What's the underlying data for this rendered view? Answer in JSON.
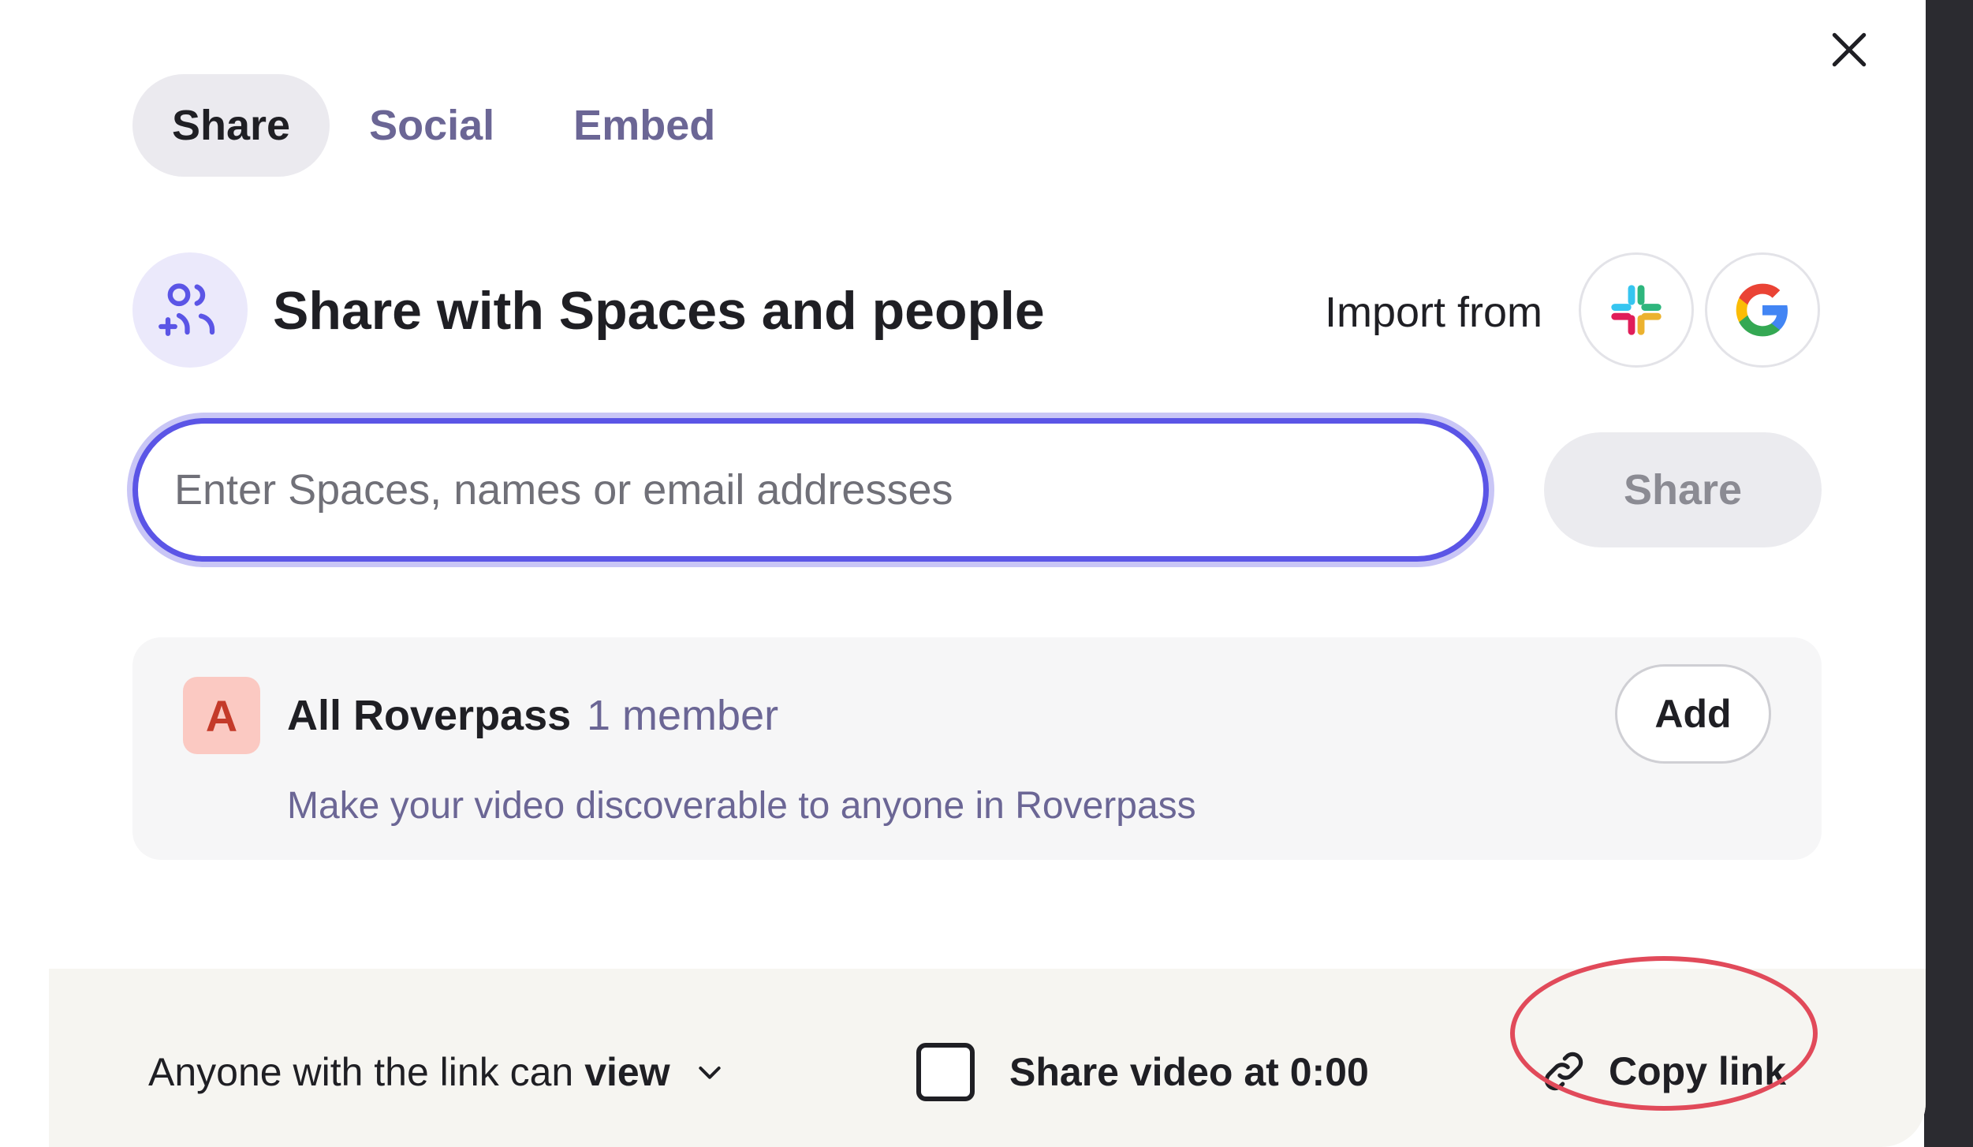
{
  "tabs": [
    {
      "label": "Share",
      "active": true
    },
    {
      "label": "Social",
      "active": false
    },
    {
      "label": "Embed",
      "active": false
    }
  ],
  "heading": "Share with Spaces and people",
  "import": {
    "label": "Import from",
    "sources": [
      "slack-icon",
      "google-icon"
    ]
  },
  "search": {
    "placeholder": "Enter Spaces, names or email addresses",
    "value": ""
  },
  "share_button": "Share",
  "space": {
    "initial": "A",
    "name": "All Roverpass",
    "count": "1 member",
    "description": "Make your video discoverable to anyone in Roverpass",
    "add_label": "Add"
  },
  "footer": {
    "permission_prefix": "Anyone with the link can",
    "permission_value": "view",
    "share_time_label": "Share video at 0:00",
    "share_time_checked": false,
    "copy_link_label": "Copy link"
  },
  "colors": {
    "accent": "#5b55e6",
    "annotation": "#e14a5a",
    "muted_text": "#6b6695"
  },
  "icons": {
    "close": "close-icon",
    "people": "people-icon",
    "chevron": "chevron-down-icon",
    "link": "link-icon"
  }
}
